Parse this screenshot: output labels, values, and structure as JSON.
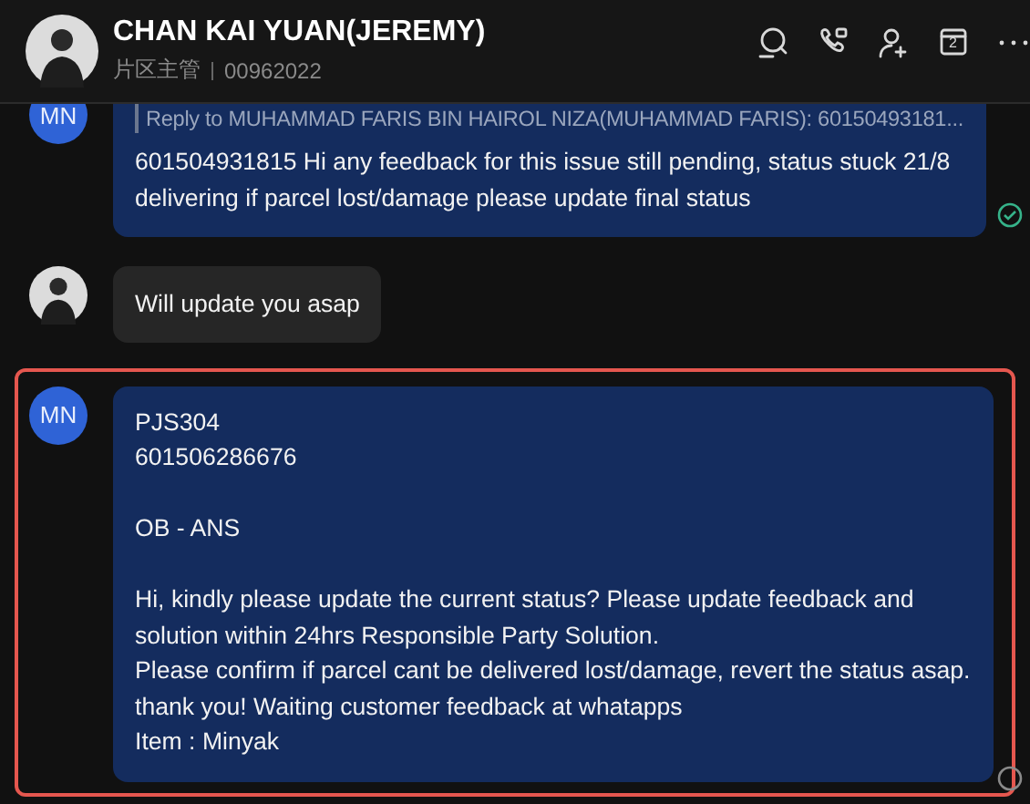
{
  "header": {
    "avatar": {
      "kind": "photo"
    },
    "name": "CHAN KAI YUAN(JEREMY)",
    "role": "片区主管",
    "id": "00962022",
    "actions": [
      {
        "kind": "search"
      },
      {
        "kind": "call"
      },
      {
        "kind": "add-user"
      },
      {
        "kind": "calendar",
        "badge": "2"
      },
      {
        "kind": "more"
      }
    ]
  },
  "messages": [
    {
      "avatar": {
        "kind": "initials",
        "text": "MN"
      },
      "kind": "outgoing",
      "quote": "Reply to MUHAMMAD FARIS BIN HAIROL NIZA(MUHAMMAD FARIS):  60150493181...",
      "blocks": [
        {
          "lines": [
            "601504931815 Hi any feedback for this issue still pending, status stuck 21/8 delivering  if parcel lost/damage please update final status"
          ]
        }
      ],
      "read": true,
      "highlighted": false
    },
    {
      "avatar": {
        "kind": "photo"
      },
      "kind": "incoming",
      "blocks": [
        {
          "lines": [
            "Will update you asap"
          ]
        }
      ],
      "highlighted": false
    },
    {
      "avatar": {
        "kind": "initials",
        "text": "MN"
      },
      "kind": "outgoing",
      "blocks": [
        {
          "lines": [
            "PJS304",
            "601506286676"
          ]
        },
        {
          "lines": [
            "OB - ANS"
          ]
        },
        {
          "lines": [
            "Hi, kindly please update the current status? Please update feedback and solution within 24hrs Responsible Party Solution.",
            "Please confirm if parcel cant be delivered lost/damage, revert the status asap. thank you! Waiting customer feedback at whatapps",
            "Item : Minyak"
          ]
        }
      ],
      "read": false,
      "highlighted": true
    }
  ]
}
